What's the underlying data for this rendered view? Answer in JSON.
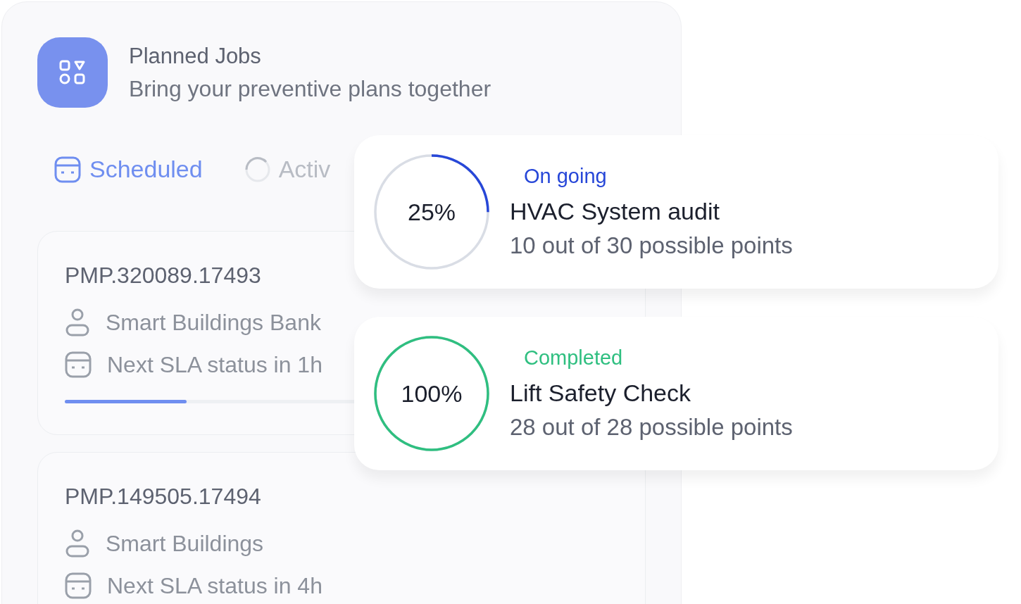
{
  "header": {
    "title": "Planned Jobs",
    "subtitle": "Bring your preventive plans together"
  },
  "tabs": [
    {
      "label": "Scheduled",
      "kind": "calendar",
      "selected": true
    },
    {
      "label": "Activ",
      "kind": "spinner",
      "selected": false
    }
  ],
  "jobs": [
    {
      "id": "PMP.320089.17493",
      "details": [
        {
          "kind": "client",
          "text": "Smart Buildings Bank"
        },
        {
          "kind": "sla",
          "text": "Next SLA status in 1h"
        }
      ],
      "progress": {
        "level": 0.22
      }
    },
    {
      "id": "PMP.149505.17494",
      "details": [
        {
          "kind": "client",
          "text": "Smart Buildings"
        },
        {
          "kind": "sla",
          "text": "Next SLA status in 4h"
        }
      ]
    }
  ],
  "audits": [
    {
      "percent": "25%",
      "level": 0.25,
      "status": "On going",
      "color": "#2747d8",
      "title": "HVAC System audit",
      "points": "10 out of 30 possible points"
    },
    {
      "percent": "100%",
      "level": 1,
      "status": "Completed",
      "color": "#2fbf80",
      "title": "Lift Safety Check",
      "points": "28 out of 28 possible points"
    }
  ]
}
